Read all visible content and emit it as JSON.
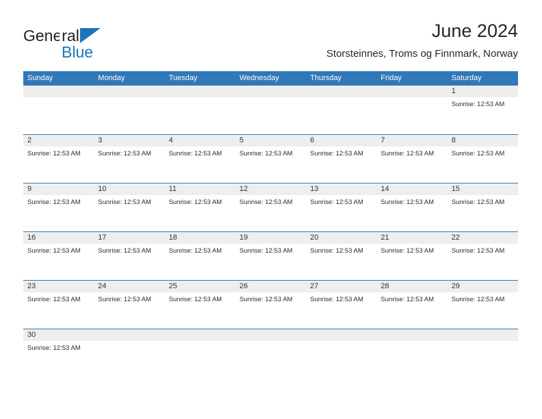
{
  "brand": {
    "name_part1": "General",
    "name_part2": "Blue",
    "flag_icon": "blue-triangle-flag-icon",
    "accent_color": "#1b75bb"
  },
  "header": {
    "title": "June 2024",
    "subtitle": "Storsteinnes, Troms og Finnmark, Norway"
  },
  "calendar": {
    "header_color": "#3178b8",
    "row_divider_color": "#3178b8",
    "daynum_strip_color": "#eeeeee",
    "weekdays": [
      "Sunday",
      "Monday",
      "Tuesday",
      "Wednesday",
      "Thursday",
      "Friday",
      "Saturday"
    ],
    "weeks": [
      [
        {
          "day": "",
          "sunrise": ""
        },
        {
          "day": "",
          "sunrise": ""
        },
        {
          "day": "",
          "sunrise": ""
        },
        {
          "day": "",
          "sunrise": ""
        },
        {
          "day": "",
          "sunrise": ""
        },
        {
          "day": "",
          "sunrise": ""
        },
        {
          "day": "1",
          "sunrise": "Sunrise: 12:53 AM"
        }
      ],
      [
        {
          "day": "2",
          "sunrise": "Sunrise: 12:53 AM"
        },
        {
          "day": "3",
          "sunrise": "Sunrise: 12:53 AM"
        },
        {
          "day": "4",
          "sunrise": "Sunrise: 12:53 AM"
        },
        {
          "day": "5",
          "sunrise": "Sunrise: 12:53 AM"
        },
        {
          "day": "6",
          "sunrise": "Sunrise: 12:53 AM"
        },
        {
          "day": "7",
          "sunrise": "Sunrise: 12:53 AM"
        },
        {
          "day": "8",
          "sunrise": "Sunrise: 12:53 AM"
        }
      ],
      [
        {
          "day": "9",
          "sunrise": "Sunrise: 12:53 AM"
        },
        {
          "day": "10",
          "sunrise": "Sunrise: 12:53 AM"
        },
        {
          "day": "11",
          "sunrise": "Sunrise: 12:53 AM"
        },
        {
          "day": "12",
          "sunrise": "Sunrise: 12:53 AM"
        },
        {
          "day": "13",
          "sunrise": "Sunrise: 12:53 AM"
        },
        {
          "day": "14",
          "sunrise": "Sunrise: 12:53 AM"
        },
        {
          "day": "15",
          "sunrise": "Sunrise: 12:53 AM"
        }
      ],
      [
        {
          "day": "16",
          "sunrise": "Sunrise: 12:53 AM"
        },
        {
          "day": "17",
          "sunrise": "Sunrise: 12:53 AM"
        },
        {
          "day": "18",
          "sunrise": "Sunrise: 12:53 AM"
        },
        {
          "day": "19",
          "sunrise": "Sunrise: 12:53 AM"
        },
        {
          "day": "20",
          "sunrise": "Sunrise: 12:53 AM"
        },
        {
          "day": "21",
          "sunrise": "Sunrise: 12:53 AM"
        },
        {
          "day": "22",
          "sunrise": "Sunrise: 12:53 AM"
        }
      ],
      [
        {
          "day": "23",
          "sunrise": "Sunrise: 12:53 AM"
        },
        {
          "day": "24",
          "sunrise": "Sunrise: 12:53 AM"
        },
        {
          "day": "25",
          "sunrise": "Sunrise: 12:53 AM"
        },
        {
          "day": "26",
          "sunrise": "Sunrise: 12:53 AM"
        },
        {
          "day": "27",
          "sunrise": "Sunrise: 12:53 AM"
        },
        {
          "day": "28",
          "sunrise": "Sunrise: 12:53 AM"
        },
        {
          "day": "29",
          "sunrise": "Sunrise: 12:53 AM"
        }
      ],
      [
        {
          "day": "30",
          "sunrise": "Sunrise: 12:53 AM"
        },
        {
          "day": "",
          "sunrise": ""
        },
        {
          "day": "",
          "sunrise": ""
        },
        {
          "day": "",
          "sunrise": ""
        },
        {
          "day": "",
          "sunrise": ""
        },
        {
          "day": "",
          "sunrise": ""
        },
        {
          "day": "",
          "sunrise": ""
        }
      ]
    ]
  }
}
